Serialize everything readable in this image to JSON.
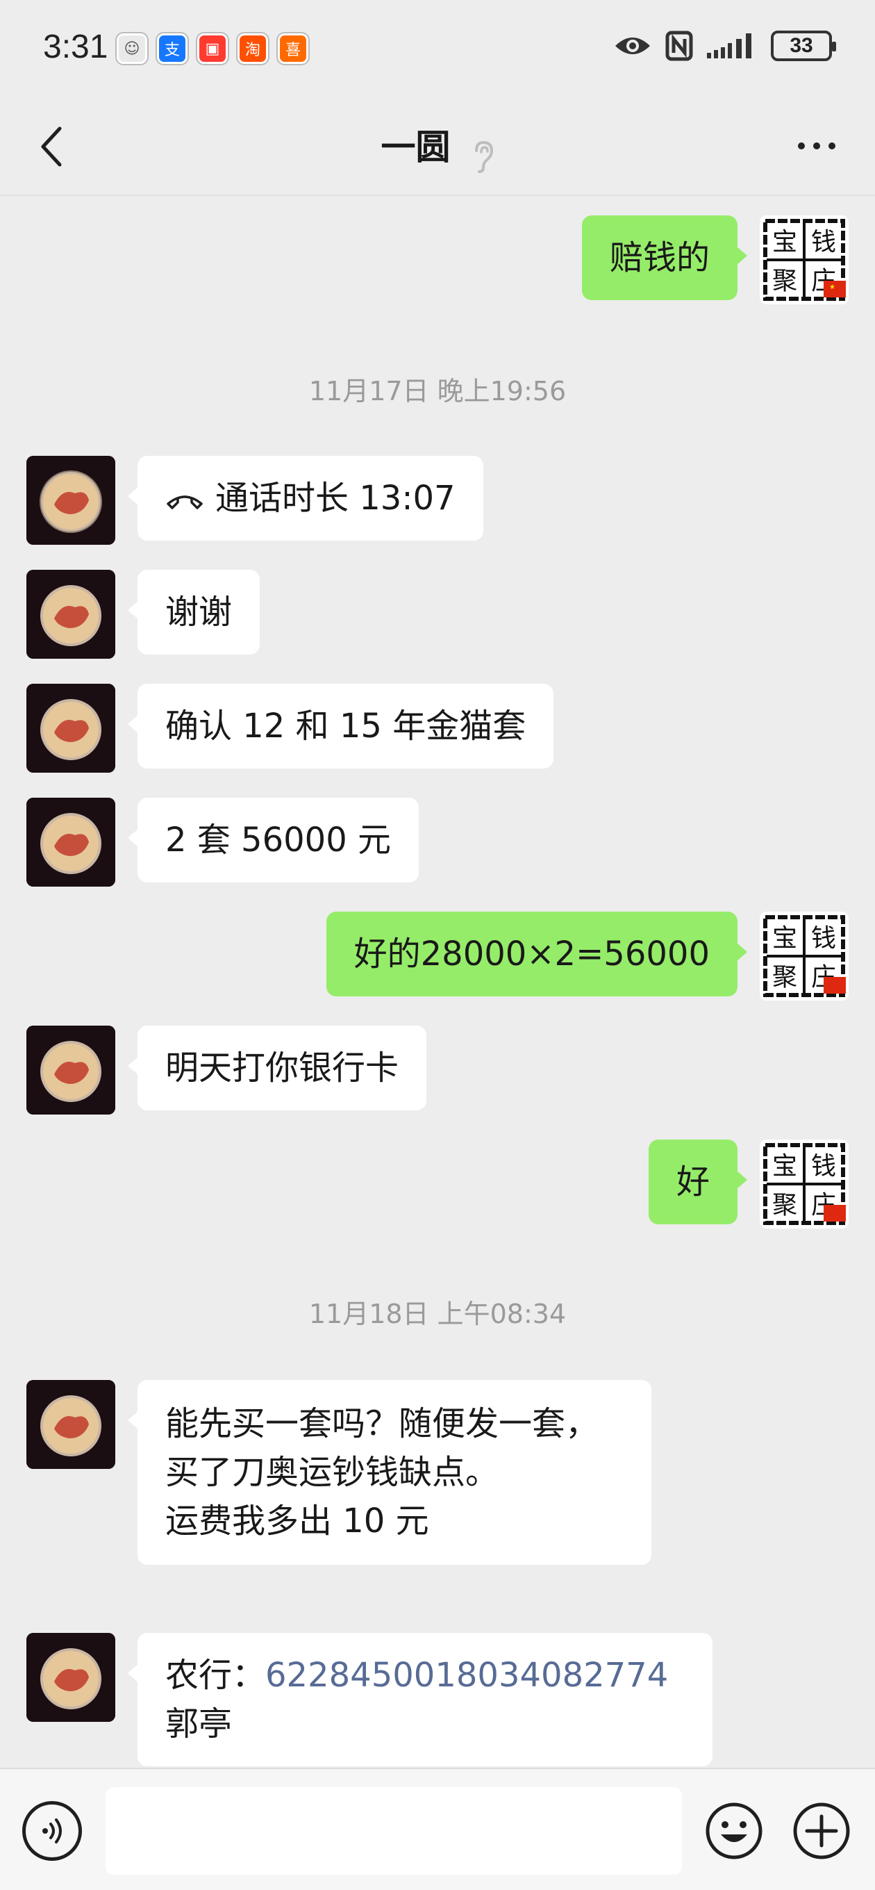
{
  "status_bar": {
    "time": "3:31",
    "battery": "33",
    "app_icons": [
      {
        "name": "app-icon-1",
        "glyph": "☺",
        "color": "#e9e9e9"
      },
      {
        "name": "alipay-icon",
        "glyph": "支",
        "color": "#1677ff"
      },
      {
        "name": "app-icon-3",
        "glyph": "▣",
        "color": "#ff3b30"
      },
      {
        "name": "taobao-icon",
        "glyph": "淘",
        "color": "#ff5000"
      },
      {
        "name": "app-icon-5",
        "glyph": "喜",
        "color": "#ff6a00"
      }
    ]
  },
  "header": {
    "title": "一圆"
  },
  "messages": [
    {
      "side": "right",
      "text": "赔钱的"
    },
    {
      "type": "timestamp",
      "text": "11月17日 晚上19:56"
    },
    {
      "side": "left",
      "type": "call",
      "text": "通话时长 13:07"
    },
    {
      "side": "left",
      "text": "谢谢"
    },
    {
      "side": "left",
      "text": "确认 12 和 15 年金猫套"
    },
    {
      "side": "left",
      "text": "2 套 56000 元"
    },
    {
      "side": "right",
      "text": "好的28000×2=56000"
    },
    {
      "side": "left",
      "text": "明天打你银行卡"
    },
    {
      "side": "right",
      "text": "好"
    },
    {
      "type": "timestamp",
      "text": "11月18日 上午08:34"
    },
    {
      "side": "left",
      "lines": [
        "能先买一套吗？随便发一套，",
        "买了刀奥运钞钱缺点。",
        "运费我多出 10 元"
      ]
    },
    {
      "side": "left",
      "bank": {
        "label": "农行：",
        "account": "6228450018034082774",
        "name": "郭亭"
      }
    }
  ],
  "seal_avatar": {
    "chars": [
      "宝",
      "钱",
      "聚",
      "庄"
    ]
  }
}
